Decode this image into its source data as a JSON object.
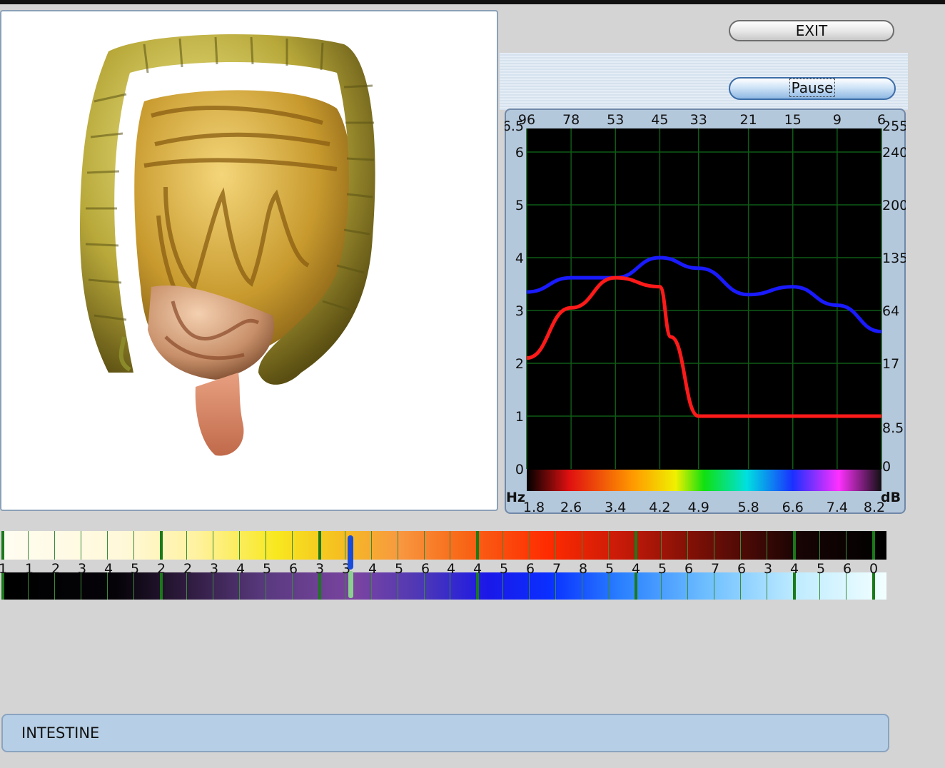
{
  "buttons": {
    "exit_label": "EXIT",
    "pause_label": "Pause"
  },
  "organ": {
    "name": "INTESTINE"
  },
  "status": {
    "text": "INTESTINE"
  },
  "chart_data": {
    "type": "line",
    "top_axis_ticks": [
      "96",
      "78",
      "53",
      "45",
      "33",
      "21",
      "15",
      "9",
      "6"
    ],
    "bottom_axis_ticks": [
      "1.8",
      "2.6",
      "3.4",
      "4.2",
      "4.9",
      "5.8",
      "6.6",
      "7.4",
      "8.2"
    ],
    "bottom_axis_highlight": "4.9",
    "bottom_axis_unit": "Hz",
    "left_axis_ticks": [
      "6.5",
      "6",
      "5",
      "4",
      "3",
      "2",
      "1",
      "0"
    ],
    "right_axis_ticks": [
      "255",
      "240",
      "200",
      "135",
      "64",
      "17",
      "8.5",
      "0"
    ],
    "right_axis_unit": "dB",
    "ylim": [
      0,
      6.5
    ],
    "grid": true,
    "colors": {
      "background": "#000000",
      "grid": "#0e5a16",
      "series_blue": "#1a1aff",
      "series_red": "#ff1a1a"
    },
    "series": [
      {
        "color": "#1a1aff",
        "x": [
          1.8,
          2.6,
          3.4,
          4.2,
          4.9,
          5.8,
          6.6,
          7.4,
          8.2
        ],
        "y": [
          3.35,
          3.62,
          3.62,
          4.0,
          3.8,
          3.3,
          3.45,
          3.1,
          2.6
        ]
      },
      {
        "color": "#ff1a1a",
        "x": [
          1.8,
          2.6,
          3.4,
          4.2,
          4.4,
          4.9,
          5.8,
          6.6,
          7.4,
          8.2
        ],
        "y": [
          2.1,
          3.05,
          3.62,
          3.45,
          2.5,
          1.0,
          1.0,
          1.0,
          1.0,
          1.0
        ]
      }
    ]
  },
  "spectrum_strip": {
    "numbers": [
      "1",
      "1",
      "2",
      "3",
      "4",
      "5",
      "2",
      "2",
      "3",
      "4",
      "5",
      "6",
      "3",
      "3",
      "4",
      "5",
      "6",
      "4",
      "4",
      "5",
      "6",
      "7",
      "8",
      "5",
      "4",
      "5",
      "6",
      "7",
      "6",
      "3",
      "4",
      "5",
      "6",
      "0"
    ]
  }
}
